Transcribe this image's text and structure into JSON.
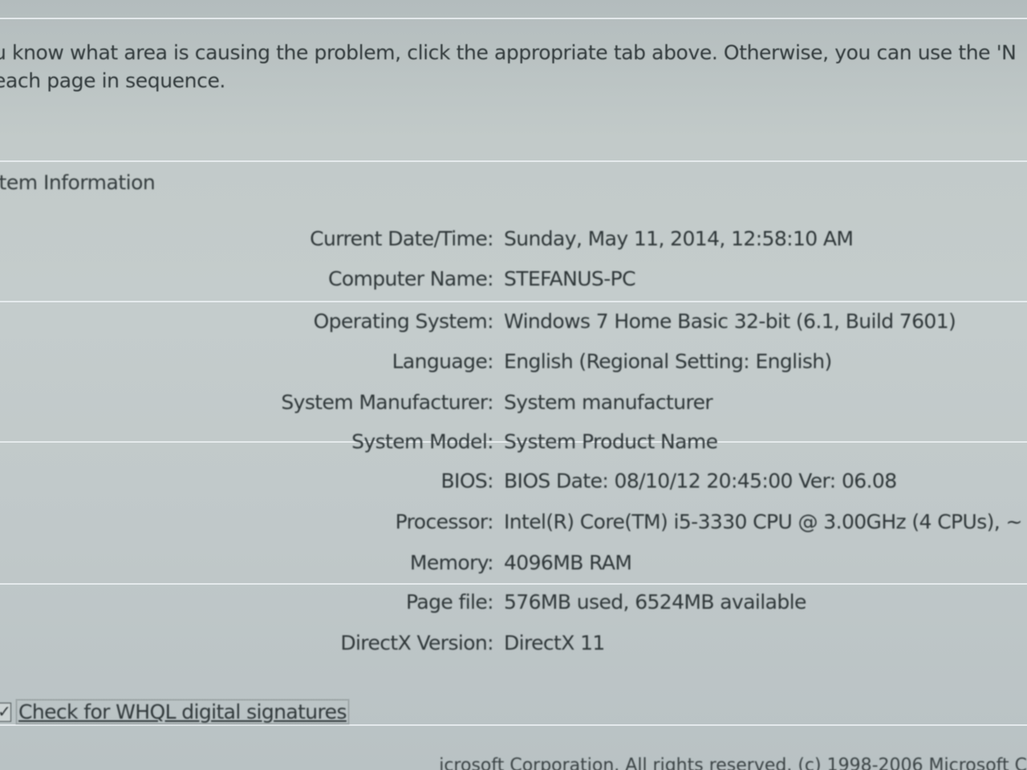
{
  "intro": {
    "line1": "u know what area is causing the problem, click the appropriate tab above.  Otherwise, you can use the 'N",
    "line2": "each page in sequence."
  },
  "system_info": {
    "group_label": "stem Information",
    "rows": [
      {
        "label": "Current Date/Time:",
        "value": "Sunday, May 11, 2014, 12:58:10 AM"
      },
      {
        "label": "Computer Name:",
        "value": "STEFANUS-PC"
      },
      {
        "label": "Operating System:",
        "value": "Windows 7 Home Basic 32-bit (6.1, Build 7601)"
      },
      {
        "label": "Language:",
        "value": "English (Regional Setting: English)"
      },
      {
        "label": "System Manufacturer:",
        "value": "System manufacturer"
      },
      {
        "label": "System Model:",
        "value": "System Product Name"
      },
      {
        "label": "BIOS:",
        "value": "BIOS Date: 08/10/12 20:45:00 Ver: 06.08"
      },
      {
        "label": "Processor:",
        "value": "Intel(R) Core(TM) i5-3330 CPU @ 3.00GHz (4 CPUs), ~"
      },
      {
        "label": "Memory:",
        "value": "4096MB RAM"
      },
      {
        "label": "Page file:",
        "value": "576MB used, 6524MB available"
      },
      {
        "label": "DirectX Version:",
        "value": "DirectX 11"
      }
    ]
  },
  "whql": {
    "label": "Check for WHQL digital signatures",
    "checked": true,
    "check_glyph": "✓"
  },
  "footer": {
    "text": "icrosoft Corporation.  All rights reserved.  (c) 1998-2006 Microsoft C"
  }
}
